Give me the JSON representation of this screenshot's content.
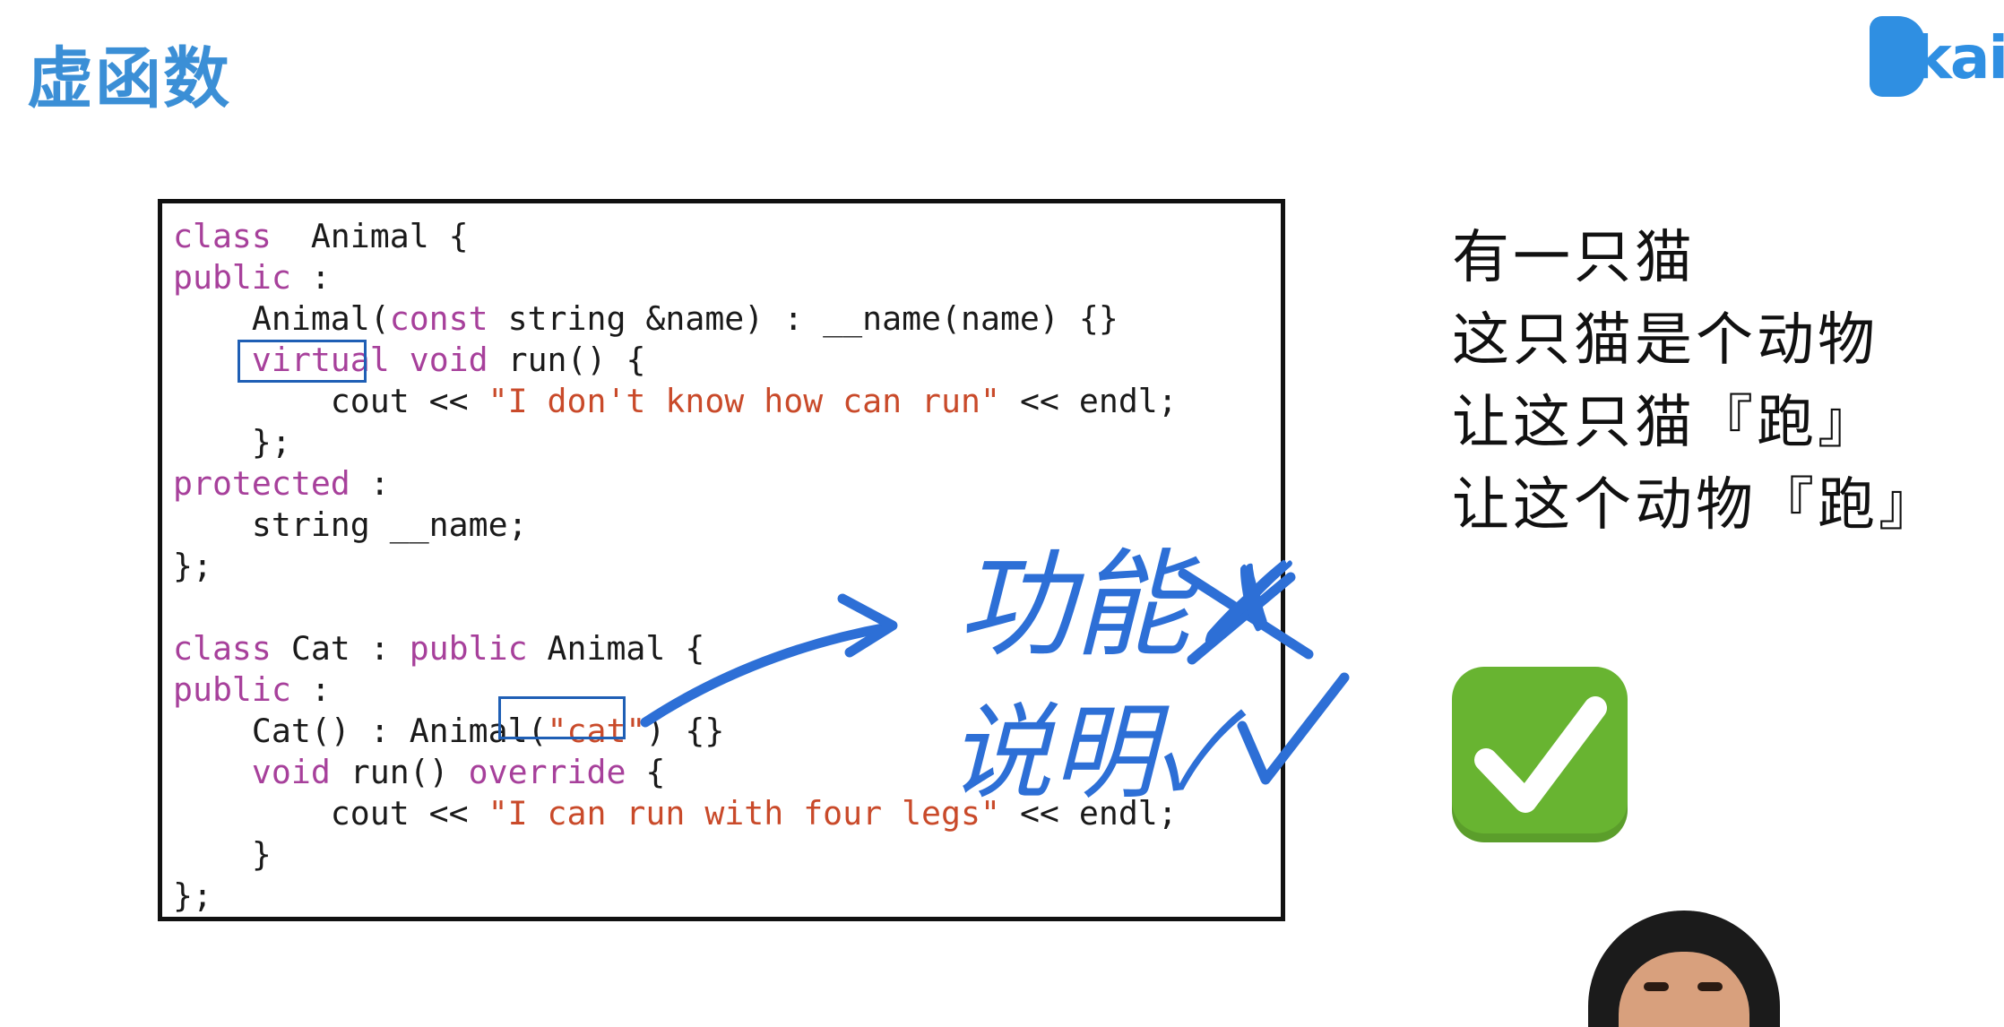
{
  "slide": {
    "title": "虚函数"
  },
  "logo": {
    "text": "kaik"
  },
  "code": {
    "lines": [
      [
        [
          "kw",
          "class"
        ],
        [
          "",
          "  Animal {"
        ]
      ],
      [
        [
          "kw",
          "public"
        ],
        [
          "",
          " :"
        ]
      ],
      [
        [
          "",
          "    Animal("
        ],
        [
          "kw",
          "const"
        ],
        [
          "",
          " string &name) : __name(name) {}"
        ]
      ],
      [
        [
          "",
          "    "
        ],
        [
          "kw",
          "virtual"
        ],
        [
          "",
          " "
        ],
        [
          "kw",
          "void"
        ],
        [
          "",
          " run() {"
        ]
      ],
      [
        [
          "",
          "        cout << "
        ],
        [
          "str",
          "\"I don't know how can run\""
        ],
        [
          "",
          " << endl;"
        ]
      ],
      [
        [
          "",
          "    };"
        ]
      ],
      [
        [
          "kw",
          "protected"
        ],
        [
          "",
          " :"
        ]
      ],
      [
        [
          "",
          "    string __name;"
        ]
      ],
      [
        [
          "",
          "};"
        ]
      ],
      [
        [
          "",
          ""
        ]
      ],
      [
        [
          "kw",
          "class"
        ],
        [
          "",
          " Cat : "
        ],
        [
          "kw",
          "public"
        ],
        [
          "",
          " Animal {"
        ]
      ],
      [
        [
          "kw",
          "public"
        ],
        [
          "",
          " :"
        ]
      ],
      [
        [
          "",
          "    Cat() : Animal("
        ],
        [
          "str",
          "\"cat\""
        ],
        [
          "",
          ") {}"
        ]
      ],
      [
        [
          "",
          "    "
        ],
        [
          "kw",
          "void"
        ],
        [
          "",
          " run() "
        ],
        [
          "kw",
          "override"
        ],
        [
          "",
          " {"
        ]
      ],
      [
        [
          "",
          "        cout << "
        ],
        [
          "str",
          "\"I can run with four legs\""
        ],
        [
          "",
          " << endl;"
        ]
      ],
      [
        [
          "",
          "    }"
        ]
      ],
      [
        [
          "",
          "};"
        ]
      ]
    ]
  },
  "statements": [
    "有一只猫",
    "这只猫是个动物",
    "让这只猫『跑』",
    "让这个动物『跑』"
  ],
  "annotations": {
    "handwriting_line1": "功能✗",
    "handwriting_line2": "说明✓"
  },
  "check_icon": "white-heavy-check-mark-icon",
  "colors": {
    "title": "#3b8fd6",
    "keyword": "#a7409b",
    "string": "#c94a2a",
    "highlight_box": "#1f5fb5",
    "handwriting": "#2d6fd6",
    "check_bg": "#68b431"
  }
}
